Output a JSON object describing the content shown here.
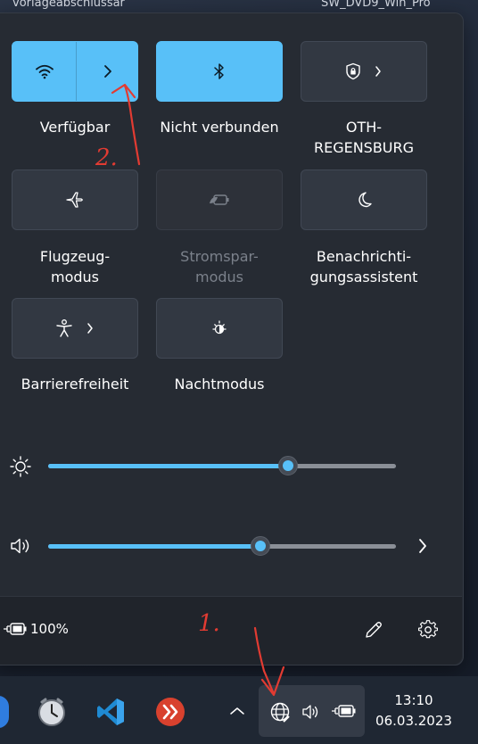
{
  "background_windows": {
    "left_title": "vorlageabschlussar",
    "right_title": "SW_DVD9_Win_Pro"
  },
  "quick_settings": {
    "tiles": [
      {
        "id": "wifi",
        "label": "Verfügbar",
        "state": "on",
        "icon": "wifi-icon",
        "has_chevron": true
      },
      {
        "id": "bluetooth",
        "label": "Nicht verbunden",
        "state": "on",
        "icon": "bluetooth-icon",
        "has_chevron": false
      },
      {
        "id": "vpn",
        "label": "OTH-\nREGENSBURG",
        "state": "off",
        "icon": "shield-icon",
        "has_chevron": true
      },
      {
        "id": "airplane",
        "label": "Flugzeug-\nmodus",
        "state": "off",
        "icon": "airplane-icon",
        "has_chevron": false
      },
      {
        "id": "battery_saver",
        "label": "Stromspar-\nmodus",
        "state": "disabled",
        "icon": "battery-saver-icon",
        "has_chevron": false
      },
      {
        "id": "focus",
        "label": "Benachrichti-\ngungsassistent",
        "state": "off",
        "icon": "moon-icon",
        "has_chevron": false
      },
      {
        "id": "accessibility",
        "label": "Barrierefreiheit",
        "state": "off",
        "icon": "accessibility-icon",
        "has_chevron": true
      },
      {
        "id": "night_light",
        "label": "Nachtmodus",
        "state": "off",
        "icon": "night-light-icon",
        "has_chevron": false
      }
    ],
    "brightness": {
      "level_percent": 69,
      "icon": "sun-icon"
    },
    "volume": {
      "level_percent": 61,
      "icon": "speaker-icon"
    },
    "battery_text": "100%",
    "edit_icon": "pencil-icon",
    "settings_icon": "gear-icon"
  },
  "annotations": {
    "step1": "1.",
    "step2": "2."
  },
  "taskbar": {
    "time": "13:10",
    "date": "06.03.2023"
  },
  "colors": {
    "accent": "#58c0f8",
    "annotation_red": "#e23b32"
  }
}
